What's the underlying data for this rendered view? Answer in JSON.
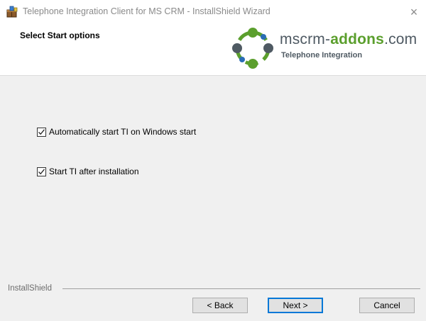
{
  "window": {
    "title": "Telephone Integration Client for MS CRM - InstallShield Wizard",
    "close_glyph": "×"
  },
  "header": {
    "title": "Select Start options",
    "logo": {
      "name_prefix": "mscrm-",
      "name_bold": "addons",
      "name_suffix": ".com",
      "tagline": "Telephone Integration",
      "colors": {
        "green": "#5b9f2d",
        "gray": "#4f5a63",
        "blue": "#2a6db5"
      }
    }
  },
  "options": [
    {
      "label": "Automatically start TI on Windows start",
      "checked": true
    },
    {
      "label": "Start TI after installation",
      "checked": true
    }
  ],
  "footer": {
    "brand": "InstallShield",
    "buttons": {
      "back": "< Back",
      "next": "Next >",
      "cancel": "Cancel"
    }
  },
  "icons": {
    "app": "installer-box-icon",
    "close": "close-icon",
    "check": "checkmark-icon"
  },
  "theme": {
    "content_bg": "#f0f0f0",
    "accent": "#0078d7"
  }
}
